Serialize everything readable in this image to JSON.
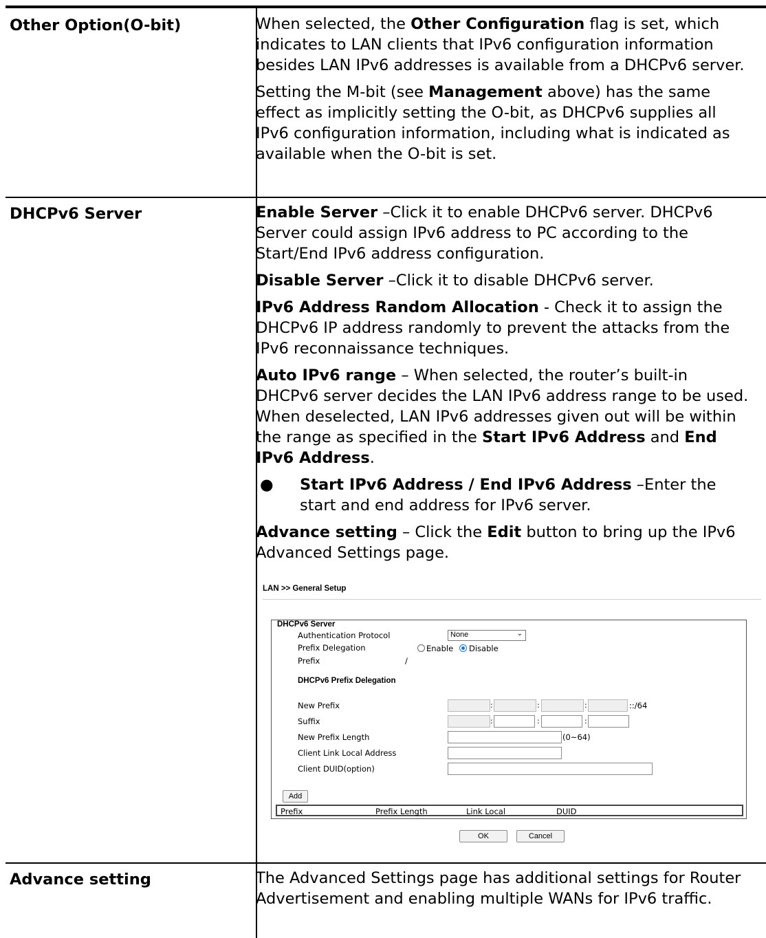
{
  "rows": [
    {
      "term": "Other Option(O-bit)",
      "paragraphs": {
        "p1_a": "When selected, the ",
        "p1_b": "Other Configuration",
        "p1_c": " flag is set, which indicates to LAN clients that IPv6 configuration information besides LAN IPv6 addresses is available from a DHCPv6 server.",
        "p2_a": "Setting the M-bit (see ",
        "p2_b": "Management",
        "p2_c": " above) has the same effect as implicitly setting the O-bit, as DHCPv6 supplies all IPv6 configuration information, including what is indicated as available when the O-bit is set."
      }
    },
    {
      "term": "DHCPv6 Server",
      "paragraphs": {
        "enable_b": "Enable Server",
        "enable_t": " –Click it to enable DHCPv6 server. DHCPv6 Server could assign IPv6 address to PC according to the Start/End IPv6 address configuration.",
        "disable_b": "Disable Server",
        "disable_t": " –Click it to disable DHCPv6 server.",
        "random_b": "IPv6 Address Random Allocation",
        "random_t": " - Check it to assign the DHCPv6 IP address randomly to prevent the attacks from the IPv6 reconnaissance techniques.",
        "auto_b": "Auto IPv6 range",
        "auto_t1": " – When selected, the router’s built-in DHCPv6 server decides the LAN IPv6 address range to be used. When deselected, LAN IPv6 addresses given out will be within the range as specified in the ",
        "auto_b2": "Start IPv6 Address",
        "auto_t2": " and ",
        "auto_b3": "End IPv6 Address",
        "auto_t3": ".",
        "bullet_b": "Start IPv6 Address / End IPv6 Address",
        "bullet_t": " –Enter the start and end address for IPv6 server.",
        "adv_b": "Advance setting",
        "adv_t1": " – Click the ",
        "adv_b2": "Edit",
        "adv_t2": " button to bring up the IPv6 Advanced Settings page."
      }
    },
    {
      "term": "Advance setting",
      "paragraphs": {
        "p1": "The Advanced Settings page has additional settings for Router Advertisement and enabling multiple WANs for IPv6 traffic."
      }
    }
  ],
  "bullet_glyph": "●",
  "screenshot": {
    "title": "LAN >> General Setup",
    "section": "DHCPv6 Server",
    "auth_label": "Authentication Protocol",
    "auth_value": "None",
    "pd_label": "Prefix Delegation",
    "pd_enable": "Enable",
    "pd_disable": "Disable",
    "pd_selected": "Disable",
    "prefix_label": "Prefix",
    "prefix_value": "/",
    "pd_section": "DHCPv6 Prefix Delegation",
    "new_prefix": "New Prefix",
    "new_prefix_suffix": "::/64",
    "suffix": "Suffix",
    "new_prefix_length": "New Prefix Length",
    "length_hint": "(0~64)",
    "client_link_local": "Client Link Local Address",
    "client_duid": "Client DUID(option)",
    "add_button": "Add",
    "table_headers": [
      "Prefix",
      "Prefix Length",
      "Link Local",
      "DUID"
    ],
    "ok_button": "OK",
    "cancel_button": "Cancel"
  }
}
